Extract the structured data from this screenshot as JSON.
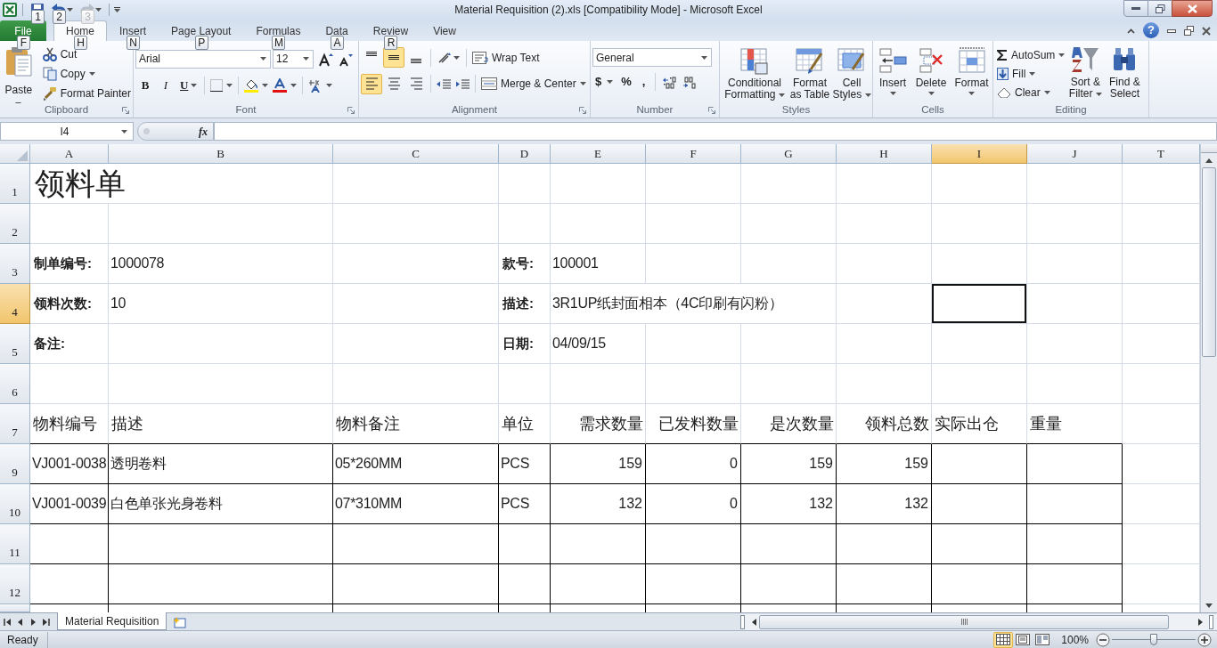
{
  "window": {
    "title": "Material Requisition (2).xls  [Compatibility Mode] - Microsoft Excel",
    "help": "?"
  },
  "quick_access": [
    {
      "kind": "save",
      "keytip": "1",
      "disabled": false
    },
    {
      "kind": "undo",
      "keytip": "2",
      "disabled": false
    },
    {
      "kind": "redo",
      "keytip": "3",
      "disabled": true
    }
  ],
  "tabs": [
    {
      "label": "File",
      "keytip": "F",
      "kind": "file",
      "selected": false
    },
    {
      "label": "Home",
      "keytip": "H",
      "kind": "tab",
      "selected": true
    },
    {
      "label": "Insert",
      "keytip": "N",
      "kind": "tab",
      "selected": false
    },
    {
      "label": "Page Layout",
      "keytip": "P",
      "kind": "tab",
      "selected": false
    },
    {
      "label": "Formulas",
      "keytip": "M",
      "kind": "tab",
      "selected": false
    },
    {
      "label": "Data",
      "keytip": "A",
      "kind": "tab",
      "selected": false
    },
    {
      "label": "Review",
      "keytip": "R",
      "kind": "tab",
      "selected": false
    },
    {
      "label": "View",
      "kind": "tab",
      "selected": false
    }
  ],
  "ribbon": {
    "clipboard": {
      "label": "Clipboard",
      "paste": "Paste",
      "cut": "Cut",
      "copy": "Copy",
      "format_painter": "Format Painter"
    },
    "font": {
      "label": "Font",
      "name": "Arial",
      "size": "12",
      "bold": "B",
      "italic": "I",
      "underline": "U"
    },
    "alignment": {
      "label": "Alignment",
      "wrap_text": "Wrap Text",
      "merge": "Merge & Center",
      "vertical": [
        {
          "selected": false
        },
        {
          "selected": true
        },
        {
          "selected": false
        }
      ],
      "horizontal": [
        {
          "selected": true
        },
        {
          "selected": false
        },
        {
          "selected": false
        }
      ]
    },
    "number": {
      "label": "Number",
      "format": "General",
      "currency": "$",
      "percent": "%",
      "comma": ","
    },
    "styles": {
      "label": "Styles",
      "conditional_formatting": "Conditional Formatting",
      "format_as_table": "Format as Table",
      "cell_styles": "Cell Styles"
    },
    "cells": {
      "label": "Cells",
      "insert": "Insert",
      "delete": "Delete",
      "format": "Format"
    },
    "editing": {
      "label": "Editing",
      "autosum": "AutoSum",
      "fill": "Fill",
      "clear": "Clear",
      "sort_filter": "Sort & Filter",
      "find_select": "Find & Select"
    }
  },
  "formula_bar": {
    "name_box": "I4",
    "fx": "fx"
  },
  "sheet": {
    "columns": [
      {
        "label": "A",
        "selected": false
      },
      {
        "label": "B",
        "selected": false
      },
      {
        "label": "C",
        "selected": false
      },
      {
        "label": "D",
        "selected": false
      },
      {
        "label": "E",
        "selected": false
      },
      {
        "label": "F",
        "selected": false
      },
      {
        "label": "G",
        "selected": false
      },
      {
        "label": "H",
        "selected": false
      },
      {
        "label": "I",
        "selected": true
      },
      {
        "label": "J",
        "selected": false
      },
      {
        "label": "T",
        "selected": false
      }
    ],
    "rows": [
      {
        "label": "1",
        "selected": false,
        "bordered": false,
        "cells": [
          {
            "text": "领料单",
            "kind": "title"
          },
          {},
          {},
          {},
          {},
          {},
          {},
          {},
          {},
          {},
          {}
        ]
      },
      {
        "label": "2",
        "selected": false,
        "bordered": false,
        "cells": [
          {},
          {},
          {},
          {},
          {},
          {},
          {},
          {},
          {},
          {},
          {}
        ]
      },
      {
        "label": "3",
        "selected": false,
        "bordered": false,
        "cells": [
          {
            "text": "制单编号:",
            "kind": "label"
          },
          {
            "text": "1000078",
            "kind": "text"
          },
          {},
          {
            "text": "款号:",
            "kind": "label"
          },
          {
            "text": "100001",
            "kind": "text"
          },
          {},
          {},
          {},
          {},
          {},
          {}
        ]
      },
      {
        "label": "4",
        "selected": true,
        "bordered": false,
        "cells": [
          {
            "text": "领料次数:",
            "kind": "label"
          },
          {
            "text": "10",
            "kind": "text"
          },
          {},
          {
            "text": "描述:",
            "kind": "label"
          },
          {
            "text": "3R1UP纸封面相本（4C印刷有闪粉）",
            "kind": "text"
          },
          {},
          {},
          {},
          {},
          {},
          {}
        ]
      },
      {
        "label": "5",
        "selected": false,
        "bordered": false,
        "cells": [
          {
            "text": "备注:",
            "kind": "label"
          },
          {},
          {},
          {
            "text": "日期:",
            "kind": "label"
          },
          {
            "text": "04/09/15",
            "kind": "text"
          },
          {},
          {},
          {},
          {},
          {},
          {}
        ]
      },
      {
        "label": "6",
        "selected": false,
        "bordered": false,
        "cells": [
          {},
          {},
          {},
          {},
          {},
          {},
          {},
          {},
          {},
          {},
          {}
        ]
      },
      {
        "label": "7",
        "selected": false,
        "bordered": false,
        "cells": [
          {
            "text": "物料编号",
            "kind": "header"
          },
          {
            "text": "描述",
            "kind": "header"
          },
          {
            "text": "物料备注",
            "kind": "header"
          },
          {
            "text": "单位",
            "kind": "header"
          },
          {
            "text": "需求数量",
            "kind": "header_num"
          },
          {
            "text": "已发料数量",
            "kind": "header_num"
          },
          {
            "text": "是次数量",
            "kind": "header_num"
          },
          {
            "text": "领料总数",
            "kind": "header_num"
          },
          {
            "text": "实际出仓",
            "kind": "header"
          },
          {
            "text": "重量",
            "kind": "header"
          },
          {}
        ]
      },
      {
        "label": "9",
        "selected": false,
        "bordered": true,
        "cells": [
          {
            "text": "VJ001-0038",
            "kind": "text"
          },
          {
            "text": "透明卷料",
            "kind": "text"
          },
          {
            "text": "05*260MM",
            "kind": "text"
          },
          {
            "text": "PCS",
            "kind": "text"
          },
          {
            "text": "159",
            "kind": "number"
          },
          {
            "text": "0",
            "kind": "number"
          },
          {
            "text": "159",
            "kind": "number"
          },
          {
            "text": "159",
            "kind": "number"
          },
          {},
          {},
          {}
        ]
      },
      {
        "label": "10",
        "selected": false,
        "bordered": true,
        "cells": [
          {
            "text": "VJ001-0039",
            "kind": "text"
          },
          {
            "text": "白色单张光身卷料",
            "kind": "text"
          },
          {
            "text": "07*310MM",
            "kind": "text"
          },
          {
            "text": "PCS",
            "kind": "text"
          },
          {
            "text": "132",
            "kind": "number"
          },
          {
            "text": "0",
            "kind": "number"
          },
          {
            "text": "132",
            "kind": "number"
          },
          {
            "text": "132",
            "kind": "number"
          },
          {},
          {},
          {}
        ]
      },
      {
        "label": "11",
        "selected": false,
        "bordered": true,
        "cells": [
          {},
          {},
          {},
          {},
          {},
          {},
          {},
          {},
          {},
          {},
          {}
        ]
      },
      {
        "label": "12",
        "selected": false,
        "bordered": true,
        "cells": [
          {},
          {},
          {},
          {},
          {},
          {},
          {},
          {},
          {},
          {},
          {}
        ]
      }
    ]
  },
  "sheet_tabs": [
    {
      "label": "Material Requisition",
      "selected": true
    }
  ],
  "status_bar": {
    "status": "Ready",
    "zoom": "100%",
    "zoom_slider": {
      "level": 0.5
    },
    "views": [
      {
        "kind": "normal",
        "selected": true
      },
      {
        "kind": "page_layout",
        "selected": false
      },
      {
        "kind": "page_break",
        "selected": false
      }
    ]
  }
}
